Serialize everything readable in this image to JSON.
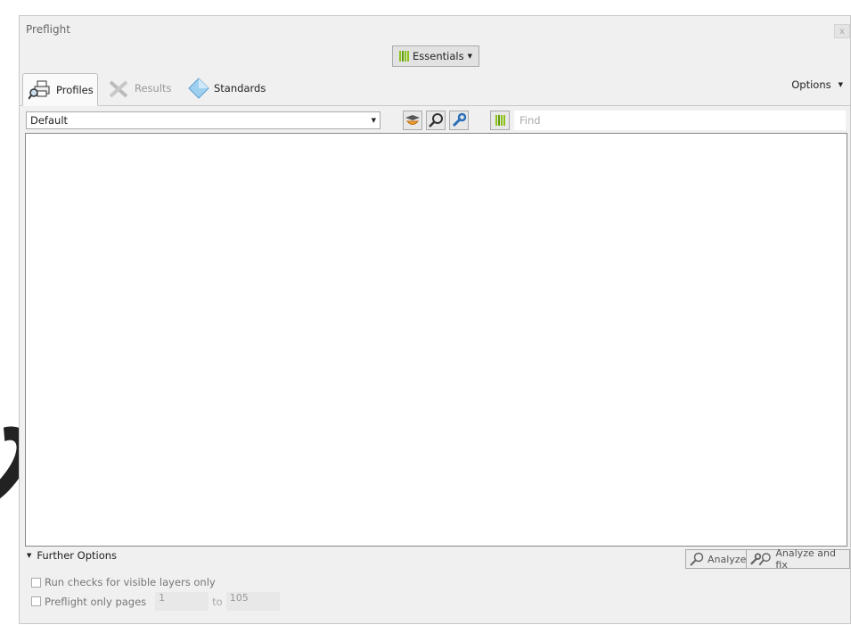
{
  "window": {
    "title": "Preflight",
    "close_label": "x"
  },
  "toolbar": {
    "essentials_label": "Essentials"
  },
  "tabs": [
    {
      "label": "Profiles",
      "active": true
    },
    {
      "label": "Results",
      "active": false
    },
    {
      "label": "Standards",
      "active": false
    }
  ],
  "options_label": "Options",
  "profile_select": {
    "value": "Default"
  },
  "search": {
    "placeholder": "Find",
    "value": ""
  },
  "further_options": {
    "label": "Further Options"
  },
  "buttons": {
    "analyze": "Analyze",
    "analyze_fix": "Analyze and fix"
  },
  "checks": {
    "visible_layers": "Run checks for visible layers only",
    "only_pages": "Preflight only pages",
    "from_page": "1",
    "to_label": "to",
    "to_page": "105"
  },
  "colors": {
    "accent_green": "#8cc21a",
    "wrench_blue": "#2a6fb8",
    "highlight_orange": "#f0a030"
  }
}
